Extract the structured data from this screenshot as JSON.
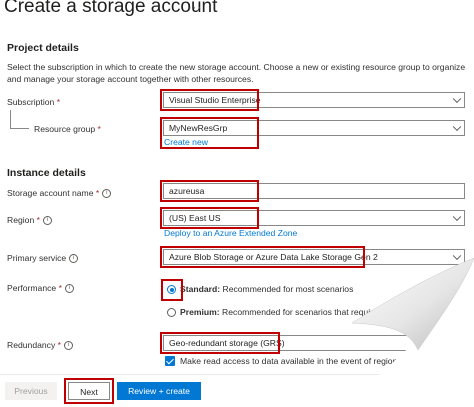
{
  "page": {
    "title": "Create a storage account",
    "more": "···"
  },
  "project": {
    "heading": "Project details",
    "description": "Select the subscription in which to create the new storage account. Choose a new or existing resource group to organize and manage your storage account together with other resources.",
    "subscription_label": "Subscription",
    "subscription_value": "Visual Studio Enterprise",
    "resource_group_label": "Resource group",
    "resource_group_value": "MyNewResGrp",
    "create_new": "Create new"
  },
  "instance": {
    "heading": "Instance details",
    "storage_name_label": "Storage account name",
    "storage_name_value": "azureusa",
    "region_label": "Region",
    "region_value": "(US) East US",
    "extended_zone_link": "Deploy to an Azure Extended Zone",
    "primary_service_label": "Primary service",
    "primary_service_value": "Azure Blob Storage or Azure Data Lake Storage Gen 2",
    "performance_label": "Performance",
    "performance_options": [
      {
        "name": "Standard:",
        "desc": "Recommended for most scenarios",
        "selected": true
      },
      {
        "name": "Premium:",
        "desc": "Recommended for scenarios that require low latency.",
        "selected": false
      }
    ],
    "redundancy_label": "Redundancy",
    "redundancy_value": "Geo-redundant storage (GRS)",
    "read_access_label": "Make read access to data available in the event of regional unavailability.",
    "required_mark": "*"
  },
  "footer": {
    "previous": "Previous",
    "next": "Next",
    "review": "Review + create"
  },
  "colors": {
    "accent": "#0078d4",
    "highlight": "#c00000"
  }
}
